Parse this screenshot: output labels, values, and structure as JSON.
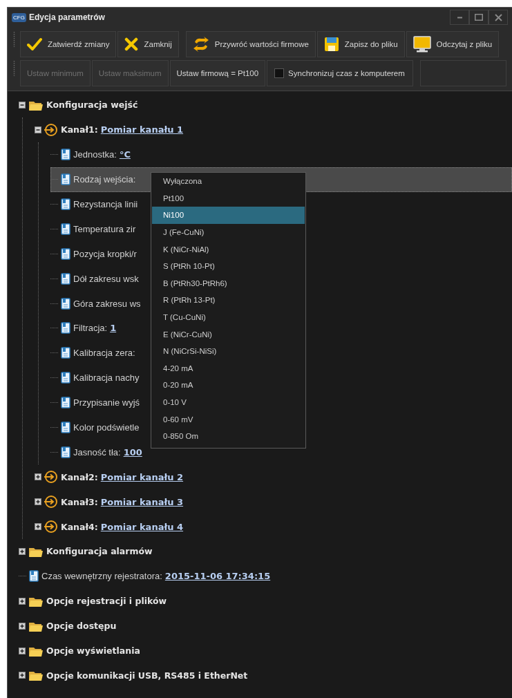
{
  "window": {
    "app_badge": "CFG",
    "title": "Edycja parametrów"
  },
  "toolbar": {
    "rows": [
      {
        "groups": [
          [
            {
              "kind": "button",
              "label": "Zatwierdź zmiany",
              "disabled": false
            },
            {
              "kind": "button",
              "label": "Zamknij",
              "disabled": false
            }
          ],
          [
            {
              "kind": "button",
              "label": "Przywróć wartości firmowe",
              "disabled": false
            },
            {
              "kind": "button",
              "label": "Zapisz do pliku",
              "disabled": false
            },
            {
              "kind": "button",
              "label": "Odczytaj z pliku",
              "disabled": false
            }
          ]
        ]
      },
      {
        "groups": [
          [
            {
              "kind": "button",
              "label": "Ustaw minimum",
              "disabled": true
            },
            {
              "kind": "button",
              "label": "Ustaw maksimum",
              "disabled": true
            },
            {
              "kind": "button",
              "label": "Ustaw firmową = Pt100",
              "disabled": false
            },
            {
              "kind": "checkbox",
              "label": "Synchronizuj czas z komputerem",
              "checked": false
            }
          ]
        ]
      }
    ]
  },
  "tree": [
    {
      "kind": "folder",
      "label": "Konfiguracja wejść",
      "expanded": true,
      "selected": false,
      "children": [
        {
          "kind": "channel",
          "label": "Kanał1:",
          "value": "Pomiar kanału 1",
          "expanded": true,
          "selected": false,
          "children": [
            {
              "kind": "param",
              "label": "Jednostka:",
              "value": "°C",
              "selected": false
            },
            {
              "kind": "param",
              "label": "Rodzaj wejścia:",
              "selected": true
            },
            {
              "kind": "param",
              "label": "Rezystancja linii",
              "selected": false
            },
            {
              "kind": "param",
              "label": "Temperatura zir",
              "selected": false
            },
            {
              "kind": "param",
              "label": "Pozycja kropki/r",
              "selected": false
            },
            {
              "kind": "param",
              "label": "Dół zakresu wsk",
              "selected": false
            },
            {
              "kind": "param",
              "label": "Góra zakresu ws",
              "selected": false
            },
            {
              "kind": "param",
              "label": "Filtracja:",
              "value": "1",
              "selected": false
            },
            {
              "kind": "param",
              "label": "Kalibracja zera:",
              "selected": false
            },
            {
              "kind": "param",
              "label": "Kalibracja nachy",
              "selected": false
            },
            {
              "kind": "param",
              "label": "Przypisanie wyjś",
              "selected": false
            },
            {
              "kind": "param",
              "label": "Kolor podświetle",
              "selected": false
            },
            {
              "kind": "param",
              "label": "Jasność tła:",
              "value": "100",
              "selected": false
            }
          ]
        },
        {
          "kind": "channel",
          "label": "Kanał2:",
          "value": "Pomiar kanału 2",
          "expanded": false,
          "selected": false
        },
        {
          "kind": "channel",
          "label": "Kanał3:",
          "value": "Pomiar kanału 3",
          "expanded": false,
          "selected": false
        },
        {
          "kind": "channel",
          "label": "Kanał4:",
          "value": "Pomiar kanału 4",
          "expanded": false,
          "selected": false
        }
      ]
    },
    {
      "kind": "folder",
      "label": "Konfiguracja alarmów",
      "expanded": false,
      "selected": false
    },
    {
      "kind": "param",
      "label": "Czas wewnętrzny rejestratora:",
      "value": "2015-11-06 17:34:15",
      "selected": false
    },
    {
      "kind": "folder",
      "label": "Opcje rejestracji i plików",
      "expanded": false,
      "selected": false
    },
    {
      "kind": "folder",
      "label": "Opcje dostępu",
      "expanded": false,
      "selected": false
    },
    {
      "kind": "folder",
      "label": "Opcje wyświetlania",
      "expanded": false,
      "selected": false
    },
    {
      "kind": "folder",
      "label": "Opcje komunikacji USB, RS485 i EtherNet",
      "expanded": false,
      "selected": false
    }
  ],
  "dropdown": {
    "options": [
      {
        "label": "Wyłączona",
        "selected": false
      },
      {
        "label": "Pt100",
        "selected": false
      },
      {
        "label": "Ni100",
        "selected": true
      },
      {
        "label": "J (Fe-CuNi)",
        "selected": false
      },
      {
        "label": "K (NiCr-NiAl)",
        "selected": false
      },
      {
        "label": "S (PtRh 10-Pt)",
        "selected": false
      },
      {
        "label": "B (PtRh30-PtRh6)",
        "selected": false
      },
      {
        "label": "R (PtRh 13-Pt)",
        "selected": false
      },
      {
        "label": "T (Cu-CuNi)",
        "selected": false
      },
      {
        "label": "E (NiCr-CuNi)",
        "selected": false
      },
      {
        "label": "N (NiCrSi-NiSi)",
        "selected": false
      },
      {
        "label": "4-20 mA",
        "selected": false
      },
      {
        "label": "0-20 mA",
        "selected": false
      },
      {
        "label": "0-10 V",
        "selected": false
      },
      {
        "label": "0-60 mV",
        "selected": false
      },
      {
        "label": "0-850 Om",
        "selected": false
      }
    ]
  }
}
